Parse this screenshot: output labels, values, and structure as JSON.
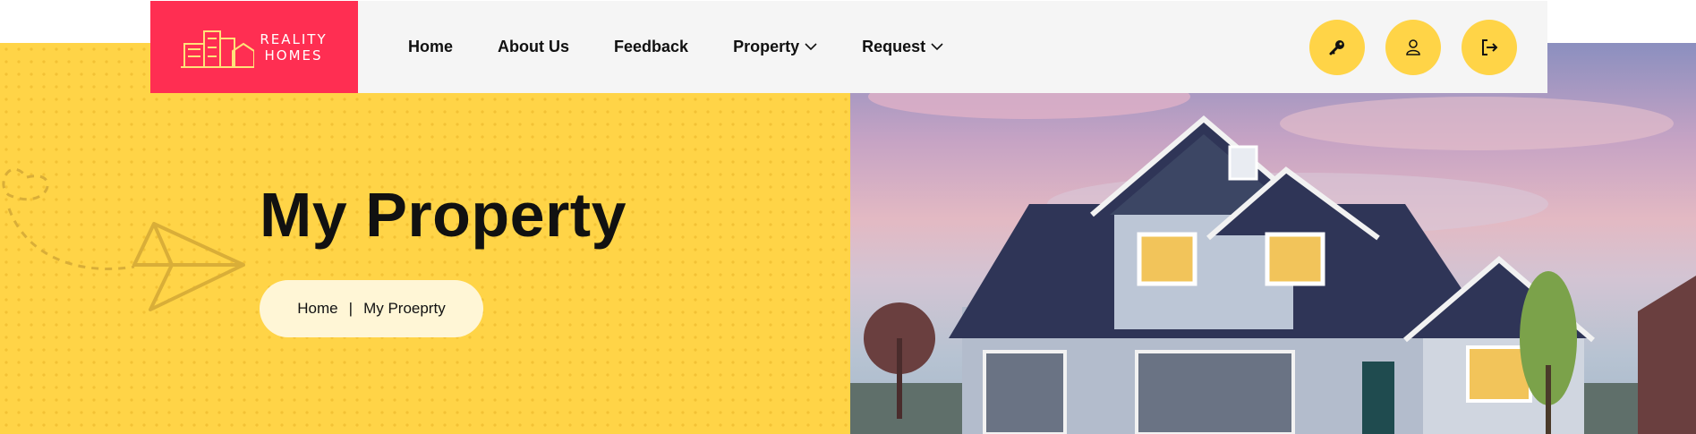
{
  "brand": {
    "logo_line1": "REALITY",
    "logo_line2": "HOMES",
    "accent": "#ff2e52",
    "highlight": "#ffd447"
  },
  "nav": {
    "items": [
      {
        "label": "Home"
      },
      {
        "label": "About Us"
      },
      {
        "label": "Feedback"
      },
      {
        "label": "Property",
        "icon": "chevron-down-icon"
      },
      {
        "label": "Request",
        "icon": "chevron-down-icon"
      }
    ]
  },
  "actions": [
    {
      "icon": "key-icon"
    },
    {
      "icon": "user-icon"
    },
    {
      "icon": "logout-icon"
    }
  ],
  "hero": {
    "title": "My Property",
    "breadcrumb": {
      "home": "Home",
      "separator": "|",
      "current": "My Proeprty"
    }
  }
}
